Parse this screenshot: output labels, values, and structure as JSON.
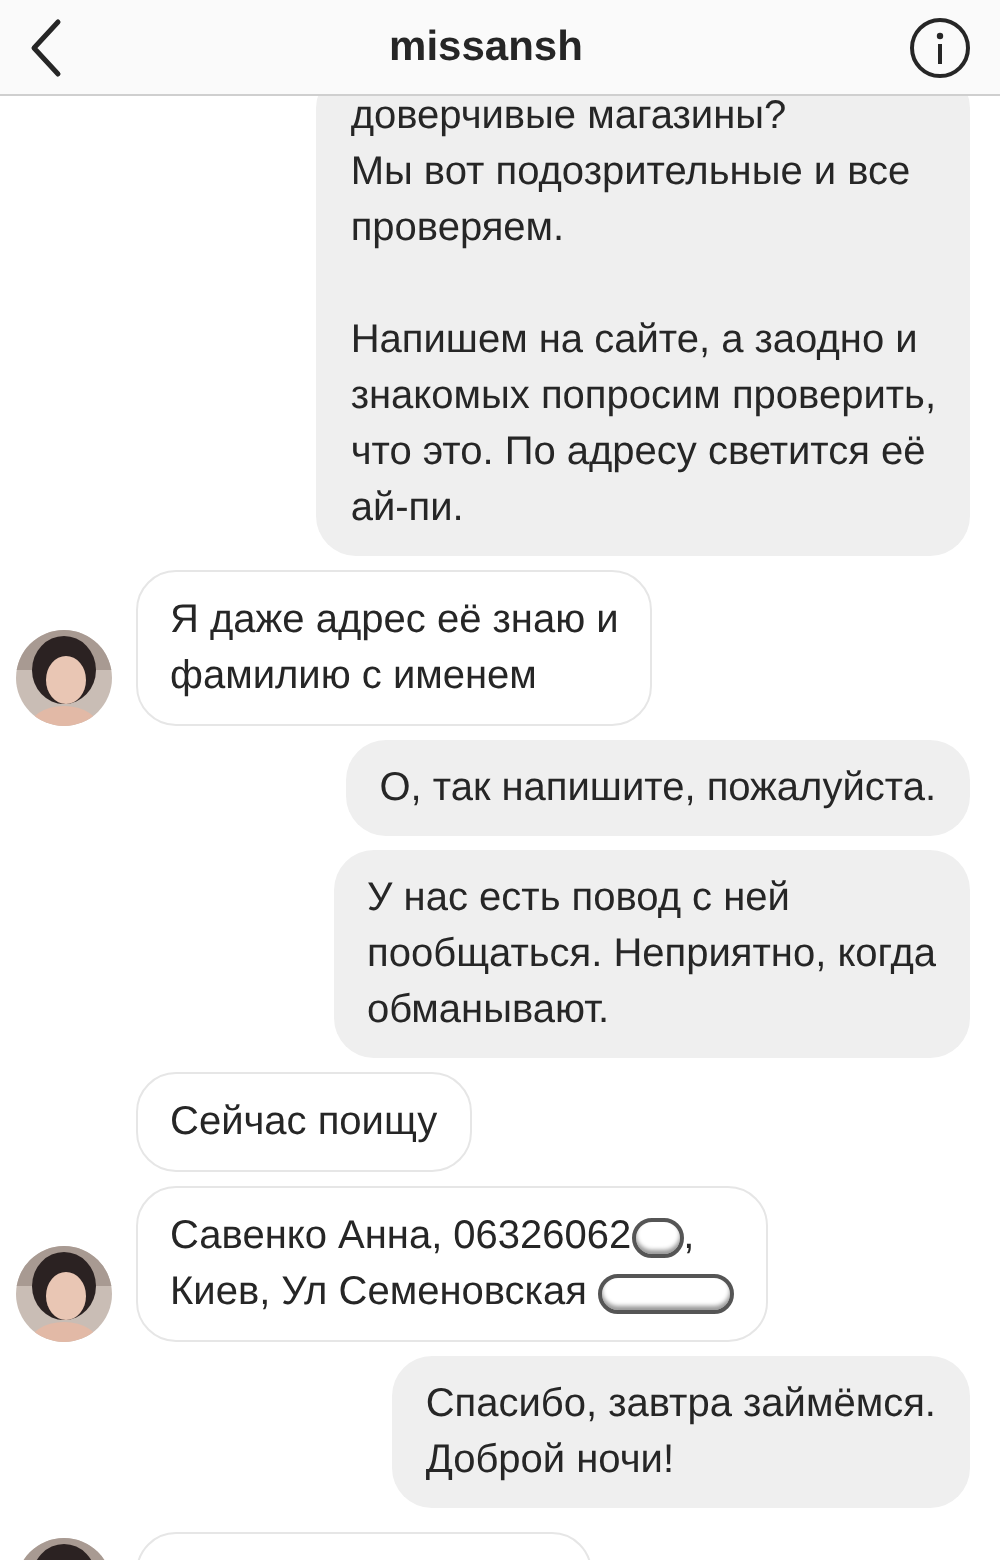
{
  "header": {
    "title": "missansh"
  },
  "messages": [
    {
      "kind": "outgoing",
      "paragraphs": [
        "доверчивые магазины?\nМы вот подозрительные и все\nпроверяем.",
        "Напишем на сайте, а заодно и\nзнакомых попросим проверить,\nчто это. По адресу светится её\nай-пи."
      ]
    },
    {
      "kind": "incoming",
      "paragraphs": [
        "Я даже адрес её знаю и\nфамилию с именем"
      ]
    },
    {
      "kind": "outgoing",
      "paragraphs": [
        "О, так напишите, пожалуйста."
      ]
    },
    {
      "kind": "outgoing",
      "paragraphs": [
        "У нас есть повод с ней\nпообщаться. Неприятно, когда\nобманывают."
      ]
    },
    {
      "kind": "incoming_plain",
      "paragraphs": [
        "Сейчас поищу"
      ]
    },
    {
      "kind": "incoming",
      "paragraphs": [
        [
          {
            "kind": "text",
            "text": "Савенко Анна, 06326062"
          },
          {
            "kind": "short_redaction"
          },
          {
            "kind": "text",
            "text": ","
          },
          {
            "kind": "break"
          },
          {
            "kind": "text",
            "text": "Киев, Ул Семеновская "
          },
          {
            "kind": "long_redaction"
          }
        ]
      ]
    },
    {
      "kind": "outgoing",
      "paragraphs": [
        "Спасибо, завтра займёмся.\nДоброй ночи!"
      ]
    },
    {
      "kind": "incoming_cut"
    }
  ]
}
